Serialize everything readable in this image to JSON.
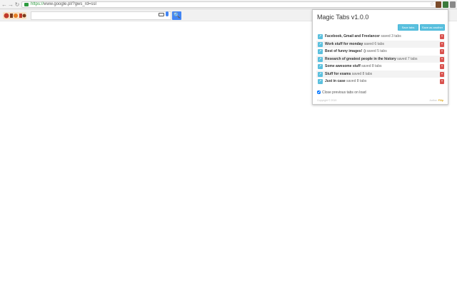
{
  "browser": {
    "back": "←",
    "forward": "→",
    "reload": "↻",
    "url_scheme": "https://",
    "url_rest": "www.google.pl/?gws_rd=ssl"
  },
  "google": {
    "search_value": "",
    "search_btn": "🔍"
  },
  "popup": {
    "title": "Magic Tabs v1.0.0",
    "save_label": "Save tabs",
    "save_another_label": "Save as another",
    "items": [
      {
        "name": "Facebook, Gmail and Freelancer",
        "meta": " saved 3 tabs"
      },
      {
        "name": "Work stuff for monday",
        "meta": " saved 6 tabs"
      },
      {
        "name": "Best of funny images! :)",
        "meta": " saved 5 tabs"
      },
      {
        "name": "Research of greatest people in the history",
        "meta": " saved 7 tabs"
      },
      {
        "name": "Some awesome stuff",
        "meta": " saved 8 tabs"
      },
      {
        "name": "Stuff for exams",
        "meta": " saved 8 tabs"
      },
      {
        "name": "Just in case",
        "meta": " saved 8 tabs"
      }
    ],
    "close_previous_label": "Close previous tabs on load",
    "copyright": "Copyright © 2015",
    "author_prefix": "Author: ",
    "author_name": "Filip"
  },
  "colors": {
    "accent": "#5bc0de",
    "delete": "#d9534f",
    "ssl": "#2e9b3f",
    "google_blue": "#4285f4"
  }
}
